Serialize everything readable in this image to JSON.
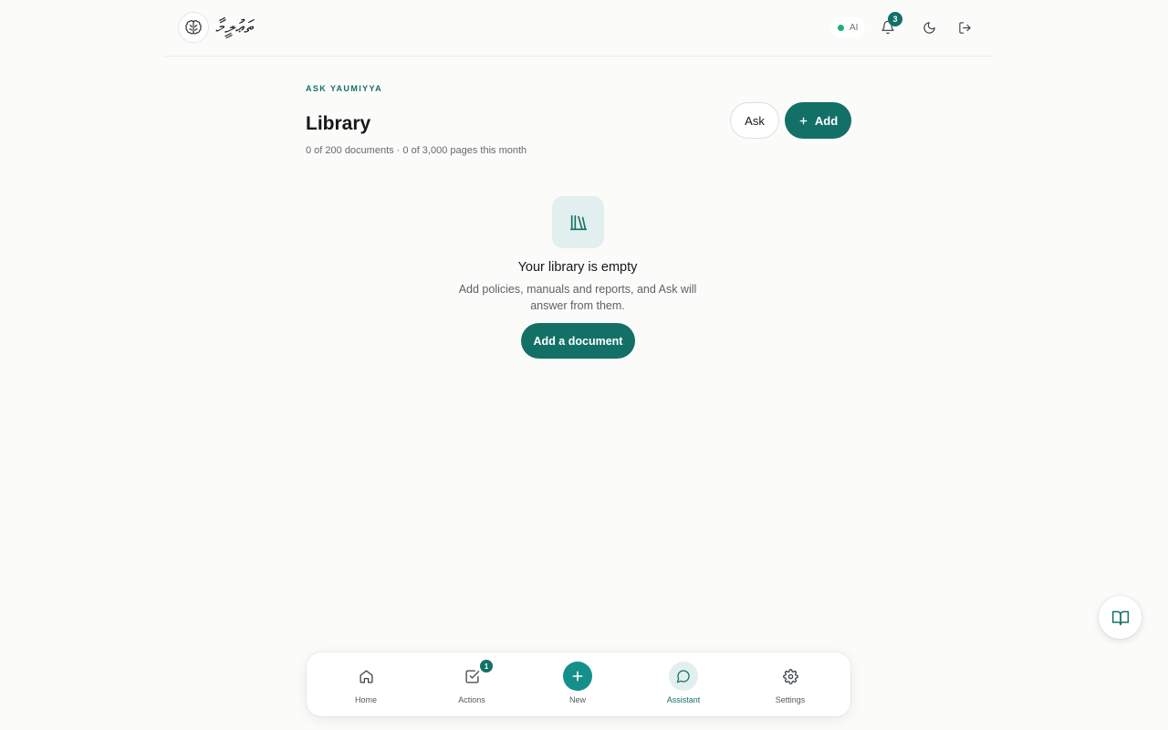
{
  "header": {
    "logo_icon": "brain-icon",
    "logo_text": "ތަޢުލީމާ",
    "ai_status_label": "AI",
    "ai_status_color": "#1fae6e",
    "notifications_count": "3",
    "icons": [
      "bell-icon",
      "moon-icon",
      "logout-icon"
    ]
  },
  "page": {
    "eyebrow": "ASK YAUMIYYA",
    "title": "Library",
    "subtitle": "0 of 200 documents · 0 of 3,000 pages this month",
    "ask_button": "Ask",
    "add_button": "Add",
    "add_button_icon": "plus-icon"
  },
  "empty_state": {
    "icon": "library-books-icon",
    "title": "Your library is empty",
    "description": "Add policies, manuals and reports, and Ask will answer from them.",
    "cta": "Add a document"
  },
  "floating_button": {
    "icon": "open-book-icon"
  },
  "bottom_nav": {
    "items": [
      {
        "label": "Home",
        "icon": "home-icon"
      },
      {
        "label": "Actions",
        "icon": "checkbox-icon",
        "badge": "1"
      },
      {
        "label": "New",
        "icon": "plus-icon"
      },
      {
        "label": "Assistant",
        "icon": "chat-bubble-icon",
        "active": true
      },
      {
        "label": "Settings",
        "icon": "gear-icon"
      }
    ]
  },
  "colors": {
    "accent": "#137067",
    "background": "#fbfbf9",
    "new_button": "#148f8a"
  }
}
